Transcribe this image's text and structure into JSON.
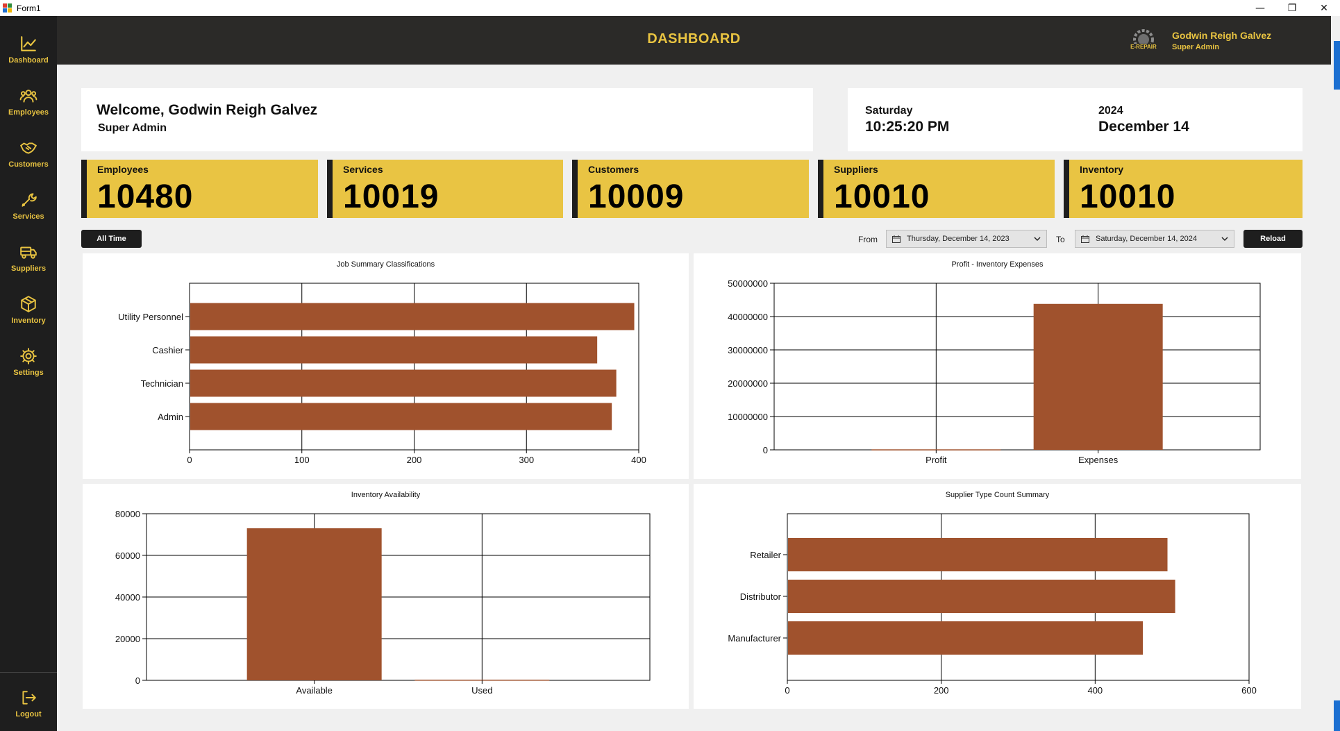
{
  "window": {
    "title": "Form1",
    "minimize": "—",
    "restore": "❐",
    "close": "✕"
  },
  "sidebar": {
    "items": [
      {
        "label": "Dashboard",
        "icon": "chart-line-icon"
      },
      {
        "label": "Employees",
        "icon": "people-icon"
      },
      {
        "label": "Customers",
        "icon": "handshake-icon"
      },
      {
        "label": "Services",
        "icon": "wrench-icon"
      },
      {
        "label": "Suppliers",
        "icon": "truck-icon"
      },
      {
        "label": "Inventory",
        "icon": "box-icon"
      },
      {
        "label": "Settings",
        "icon": "gear-icon"
      }
    ],
    "logout": {
      "label": "Logout",
      "icon": "logout-icon"
    }
  },
  "header": {
    "title": "DASHBOARD",
    "user_name": "Godwin Reigh Galvez",
    "user_role": "Super Admin",
    "logo_text": "E-REPAIR"
  },
  "welcome": {
    "title": "Welcome, Godwin Reigh Galvez",
    "role": "Super Admin"
  },
  "datetime": {
    "day": "Saturday",
    "time": "10:25:20 PM",
    "year": "2024",
    "date": "December 14"
  },
  "stats": [
    {
      "label": "Employees",
      "value": "10480"
    },
    {
      "label": "Services",
      "value": "10019"
    },
    {
      "label": "Customers",
      "value": "10009"
    },
    {
      "label": "Suppliers",
      "value": "10010"
    },
    {
      "label": "Inventory",
      "value": "10010"
    }
  ],
  "filter": {
    "all_time": "All Time",
    "from_label": "From",
    "from_value": "Thursday, December 14, 2023",
    "to_label": "To",
    "to_value": "Saturday, December 14, 2024",
    "reload": "Reload"
  },
  "colors": {
    "accent": "#e8c341",
    "bar": "#a0522d",
    "dark": "#1e1e1e",
    "header": "#2b2a28"
  },
  "chart_data": [
    {
      "type": "bar",
      "orientation": "horizontal",
      "title": "Job Summary Classifications",
      "categories": [
        "Utility Personnel",
        "Cashier",
        "Technician",
        "Admin"
      ],
      "values": [
        396,
        363,
        380,
        376
      ],
      "xlim": [
        0,
        400
      ],
      "ticks": [
        0,
        100,
        200,
        300,
        400
      ],
      "grid": true
    },
    {
      "type": "bar",
      "orientation": "vertical",
      "title": "Profit - Inventory Expenses",
      "categories": [
        "Profit",
        "Expenses"
      ],
      "values": [
        150000,
        43800000
      ],
      "ylim": [
        0,
        50000000
      ],
      "ticks": [
        0,
        10000000,
        20000000,
        30000000,
        40000000,
        50000000
      ],
      "grid": true
    },
    {
      "type": "bar",
      "orientation": "vertical",
      "title": "Inventory Availability",
      "categories": [
        "Available",
        "Used"
      ],
      "values": [
        73000,
        300
      ],
      "ylim": [
        0,
        80000
      ],
      "ticks": [
        0,
        20000,
        40000,
        60000,
        80000
      ],
      "grid": true
    },
    {
      "type": "bar",
      "orientation": "horizontal",
      "title": "Supplier Type Count Summary",
      "categories": [
        "Retailer",
        "Distributor",
        "Manufacturer"
      ],
      "values": [
        494,
        504,
        462
      ],
      "xlim": [
        0,
        600
      ],
      "ticks": [
        0,
        200,
        400,
        600
      ],
      "grid": true
    }
  ]
}
